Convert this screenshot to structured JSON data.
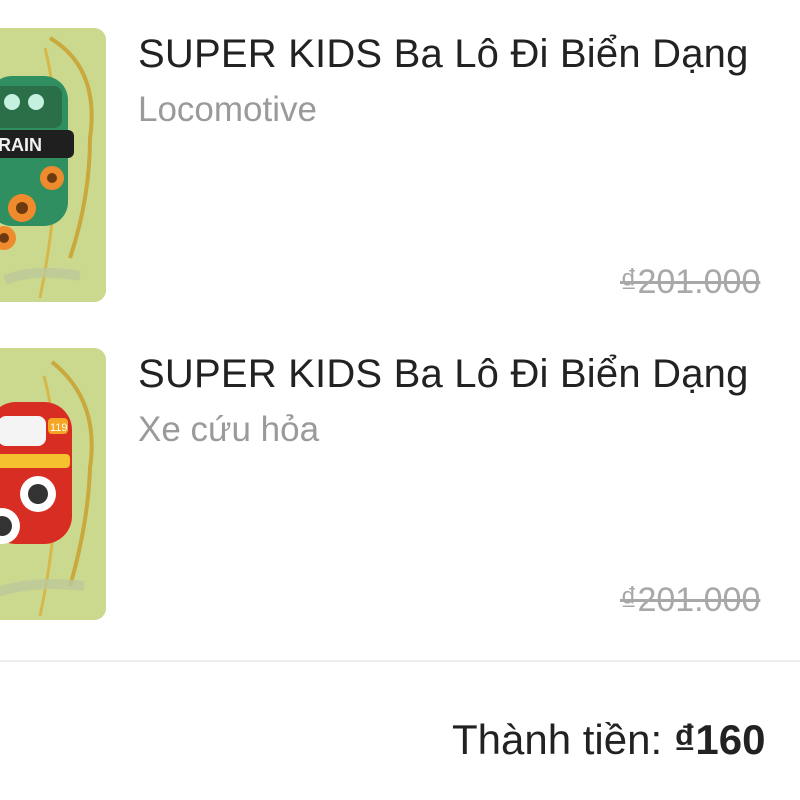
{
  "order_items": [
    {
      "title": "SUPER KIDS Ba Lô Đi Biển Dạng",
      "variant": "Locomotive",
      "old_price": "₫201.000",
      "image": "train-backpack-image",
      "image_text": "RAIN"
    },
    {
      "title": "SUPER KIDS Ba Lô Đi Biển Dạng",
      "variant": "Xe cứu hỏa",
      "old_price": "₫201.000",
      "image": "fire-truck-backpack-image",
      "image_text": "119"
    }
  ],
  "summary": {
    "total_label": "Thành tiền:",
    "total_value": "₫160"
  },
  "colors": {
    "text": "#222222",
    "muted": "#9a9a9a",
    "strike_price": "#a8a8a8",
    "divider": "#eeeeee"
  }
}
